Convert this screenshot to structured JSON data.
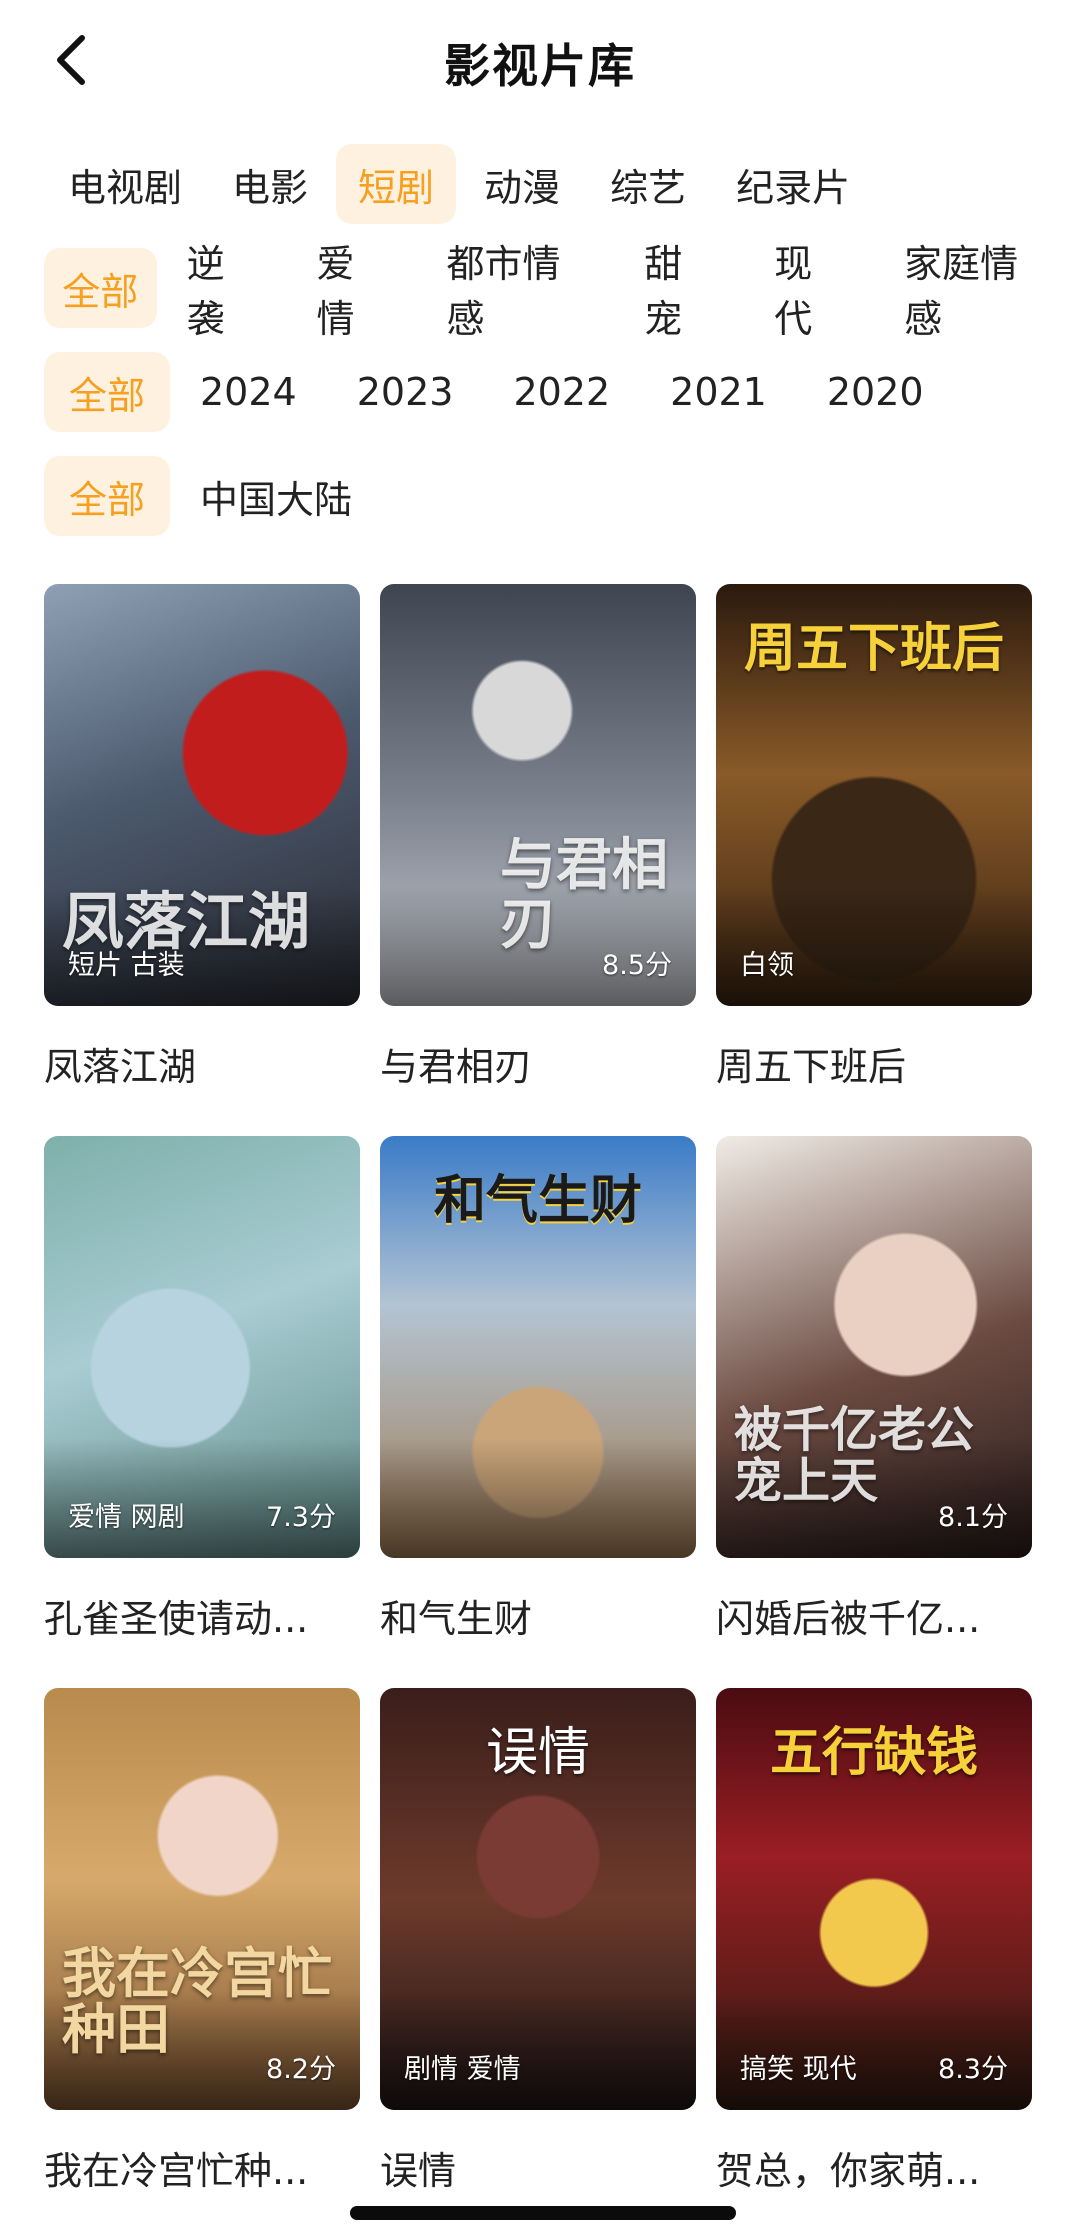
{
  "header": {
    "title": "影视片库",
    "back_icon": "chevron-left-icon"
  },
  "tabs": [
    "电视剧",
    "电影",
    "短剧",
    "动漫",
    "综艺",
    "纪录片"
  ],
  "active_tab_index": 2,
  "filters": {
    "genre": {
      "active": "全部",
      "options": [
        "逆袭",
        "爱情",
        "都市情感",
        "甜宠",
        "现代",
        "家庭情感"
      ]
    },
    "year": {
      "active": "全部",
      "options": [
        "2024",
        "2023",
        "2022",
        "2021",
        "2020"
      ]
    },
    "region": {
      "active": "全部",
      "options": [
        "中国大陆"
      ]
    }
  },
  "colors": {
    "accent": "#F5A020",
    "accent_bg": "#FFF1DF",
    "text": "#222222"
  },
  "items": [
    {
      "title": "凤落江湖",
      "tags": "短片 古装",
      "score": "",
      "poster_text": "凤落江湖",
      "poster_top": ""
    },
    {
      "title": "与君相刃",
      "tags": "",
      "score": "8.5分",
      "poster_text": "与君相刃",
      "poster_top": ""
    },
    {
      "title": "周五下班后",
      "tags": "白领",
      "score": "",
      "poster_text": "",
      "poster_top": "周五下班后"
    },
    {
      "title": "孔雀圣使请动...",
      "tags": "爱情 网剧",
      "score": "7.3分",
      "poster_text": "",
      "poster_top": ""
    },
    {
      "title": "和气生财",
      "tags": "",
      "score": "",
      "poster_text": "",
      "poster_top": "和气生财"
    },
    {
      "title": "闪婚后被千亿...",
      "tags": "",
      "score": "8.1分",
      "poster_text": "被千亿老公宠上天",
      "poster_top": ""
    },
    {
      "title": "我在冷宫忙种...",
      "tags": "",
      "score": "8.2分",
      "poster_text": "我在冷宫忙种田",
      "poster_top": ""
    },
    {
      "title": "误情",
      "tags": "剧情 爱情",
      "score": "",
      "poster_text": "",
      "poster_top": "误情"
    },
    {
      "title": "贺总，你家萌...",
      "tags": "搞笑 现代",
      "score": "8.3分",
      "poster_text": "",
      "poster_top": "五行缺钱"
    }
  ]
}
